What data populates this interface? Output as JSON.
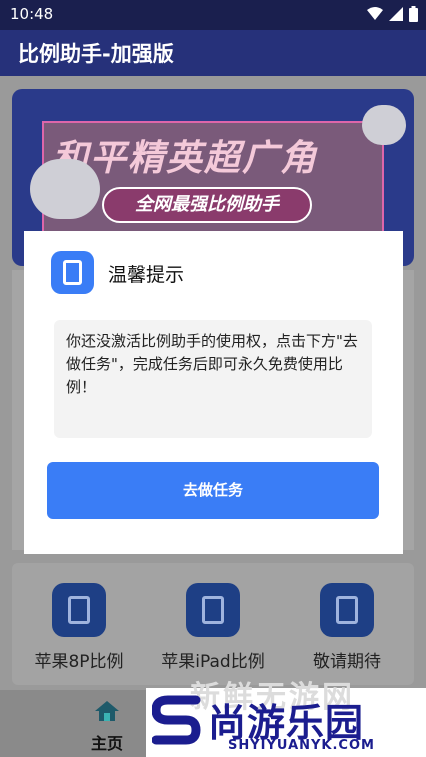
{
  "status_bar": {
    "time": "10:48"
  },
  "app_bar": {
    "title": "比例助手-加强版"
  },
  "banner": {
    "title": "和平精英超广角",
    "subtitle": "全网最强比例助手"
  },
  "tools": [
    {
      "label": "苹果8P比例"
    },
    {
      "label": "苹果iPad比例"
    },
    {
      "label": "敬请期待"
    }
  ],
  "bottom_nav": {
    "home_label": "主页"
  },
  "dialog": {
    "title": "温馨提示",
    "message": "你还没激活比例助手的使用权，点击下方\"去做任务\"，完成任务后即可永久免费使用比例！",
    "button": "去做任务"
  },
  "watermark": {
    "title": "尚游乐园",
    "url": "SHYIYUANYK.COM",
    "ghost_text": "新鲜无游网"
  },
  "colors": {
    "accent": "#3a7df6",
    "app_bar": "#26317a",
    "brand_dark": "#1b1d8f"
  }
}
